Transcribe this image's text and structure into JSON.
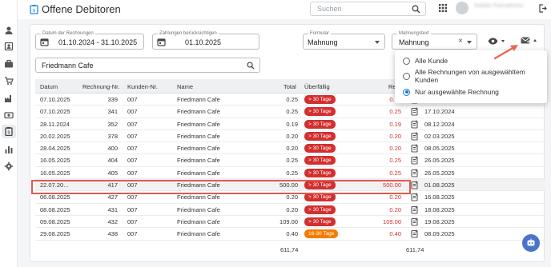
{
  "app": {
    "title": "Offene Debitoren"
  },
  "search": {
    "placeholder": "Suchen"
  },
  "user": {
    "name": "Natalie Pannathonn"
  },
  "filters": {
    "date_label": "Datum der Rechnungen",
    "date_value": "01.10.2024 - 31.10.2025",
    "payment_label": "Zahlungen berücksichtigen",
    "payment_value": "01.10.2025",
    "form_label": "Formular",
    "form_value": "Mahnung",
    "text_label": "Mahnungstext",
    "text_value": "Mahnung",
    "customer_search": "Friedmann Cafe"
  },
  "table": {
    "headers": [
      "Datum",
      "Rechnung-Nr.",
      "Kunden-Nr.",
      "Name",
      "Total",
      "Überfällig",
      "Re"
    ],
    "rows": [
      {
        "date": "07.10.2025",
        "inv": "339",
        "cust": "007",
        "name": "Friedmann Cafe",
        "total": "0.25",
        "badge": "> 30 Tage",
        "badge_type": "red",
        "rest": "0.25",
        "due": ""
      },
      {
        "date": "07.10.2025",
        "inv": "341",
        "cust": "007",
        "name": "Friedmann Cafe",
        "total": "0.25",
        "badge": "> 30 Tage",
        "badge_type": "red",
        "rest": "0.25",
        "due": "17.10.2024"
      },
      {
        "date": "28.11.2024",
        "inv": "352",
        "cust": "007",
        "name": "Friedmann Cafe",
        "total": "0.19",
        "badge": "> 30 Tage",
        "badge_type": "red",
        "rest": "0.19",
        "due": "08.12.2024"
      },
      {
        "date": "20.02.2025",
        "inv": "378",
        "cust": "007",
        "name": "Friedmann Cafe",
        "total": "0.20",
        "badge": "> 30 Tage",
        "badge_type": "red",
        "rest": "0.20",
        "due": "02.03.2025"
      },
      {
        "date": "28.04.2025",
        "inv": "400",
        "cust": "007",
        "name": "Friedmann Cafe",
        "total": "0.20",
        "badge": "> 30 Tage",
        "badge_type": "red",
        "rest": "0.20",
        "due": "08.05.2025"
      },
      {
        "date": "16.05.2025",
        "inv": "404",
        "cust": "007",
        "name": "Friedmann Cafe",
        "total": "0.25",
        "badge": "> 30 Tage",
        "badge_type": "red",
        "rest": "0.25",
        "due": "26.05.2025"
      },
      {
        "date": "16.05.2025",
        "inv": "405",
        "cust": "007",
        "name": "Friedmann Cafe",
        "total": "0.25",
        "badge": "> 30 Tage",
        "badge_type": "red",
        "rest": "0.25",
        "due": "26.05.2025"
      },
      {
        "date": "22.07.20...",
        "inv": "417",
        "cust": "007",
        "name": "Friedmann Cafe",
        "total": "500.00",
        "badge": "> 30 Tage",
        "badge_type": "red",
        "rest": "500.00",
        "due": "01.08.2025",
        "highlight": true
      },
      {
        "date": "06.08.2025",
        "inv": "427",
        "cust": "007",
        "name": "Friedmann Cafe",
        "total": "0.20",
        "badge": "> 30 Tage",
        "badge_type": "red",
        "rest": "0.20",
        "due": "16.08.2025"
      },
      {
        "date": "08.08.2025",
        "inv": "431",
        "cust": "007",
        "name": "Friedmann Cafe",
        "total": "0.20",
        "badge": "> 30 Tage",
        "badge_type": "red",
        "rest": "0.20",
        "due": "18.08.2025"
      },
      {
        "date": "09.08.2025",
        "inv": "432",
        "cust": "007",
        "name": "Friedmann Cafe",
        "total": "109.00",
        "badge": "> 30 Tage",
        "badge_type": "red",
        "rest": "109.00",
        "due": "19.08.2025"
      },
      {
        "date": "29.08.2025",
        "inv": "438",
        "cust": "007",
        "name": "Friedmann Cafe",
        "total": "0.40",
        "badge": "16-30 Tage",
        "badge_type": "orange",
        "rest": "0.40",
        "due": "08.09.2025"
      }
    ],
    "total_sum": "611,74",
    "rest_sum": "611,74"
  },
  "menu": {
    "options": [
      "Alle Kunde",
      "Alle Rechnungen von ausgewähltem Kunden",
      "Nur ausgewählte Rechnung"
    ],
    "selected": "Nur ausgewählte Rechnung"
  },
  "colors": {
    "badge_red": "#d32f2f",
    "badge_orange": "#f57c00",
    "accent": "#1976d2",
    "highlight_box": "#e05a4e"
  }
}
